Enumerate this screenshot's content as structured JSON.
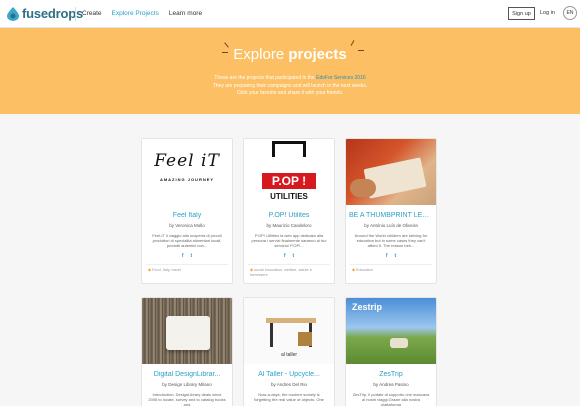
{
  "header": {
    "brand": "fusedrops",
    "nav": [
      "Create",
      "Explore Projects",
      "Learn more"
    ],
    "signup": "Sign up",
    "login": "Log in",
    "lang": "EN"
  },
  "hero": {
    "title_light": "Explore",
    "title_bold": "projects",
    "line1_pre": "These are the projects that participated in the",
    "line1_link": "EdoFor Services 2016",
    "line2": "They are preparing their campaigns and will launch in the next weeks.",
    "line3": "Click your favorite and share it with your friends."
  },
  "cards": [
    {
      "title": "Feel Italy",
      "author": "by Veronica Mollo",
      "desc": "Feel-IT il viaggio alla scoperta di piccoli produttori di specialità alimentari locali, prodotti autentici non...",
      "tags": "Food, Italy, travel"
    },
    {
      "title": "P.OP! Utilites",
      "author": "by Maurizio Candeloro",
      "desc": "P.OP! Utilities la web app dedicata alla persona i servizi finalmente saranno al tuo servizio! P.OP!...",
      "tags": "social innovation, welfare, salute e benessere"
    },
    {
      "title": "BE A THUMBPRINT LEAD...",
      "author": "by António Luís de Oliveira",
      "desc": "Around the World children are striving for education but in some cases they can't afford it. The reason beh...",
      "tags": "Education"
    },
    {
      "title": "Digital DesignLibrar...",
      "author": "by Design Library Milano",
      "desc": "Introduction: DesignLibrary deals since 2006 to locate, survey and to catalog books and",
      "tags": ""
    },
    {
      "title": "Al Taller - Upcycle...",
      "author": "by Andres Del Rio",
      "desc": "Now-a-days, the modern society is forgetting the real value of objects. One",
      "tags": ""
    },
    {
      "title": "ZesTrip",
      "author": "by Andrea Pasino",
      "desc": "ZesTrip, il portale di supporto che mancava ai nostri viaggi.Grazie alla nostra piattaforma",
      "tags": ""
    }
  ],
  "images": {
    "feel_it_script": "Feel iT",
    "feel_it_sub": "AMAZING JOURNEY",
    "pop_letters": "P.OP !",
    "pop_sub": "UTILITIES",
    "zestrip_logo": "Zestrip",
    "taller_label": "al taller"
  },
  "colors": {
    "accent": "#2aa0c8",
    "hero_bg": "#fcbf63",
    "brand": "#2c6f87"
  }
}
